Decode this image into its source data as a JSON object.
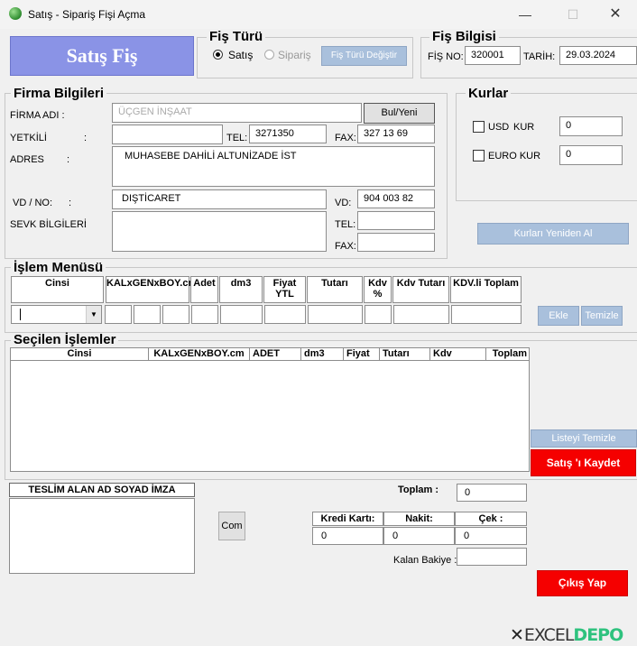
{
  "window": {
    "title": "Satış - Sipariş Fişi Açma",
    "minimize": "—",
    "maximize": "☐",
    "close": "✕"
  },
  "banner": {
    "text": "Satış Fiş"
  },
  "fis_turu": {
    "title": "Fiş Türü",
    "option_satis": "Satış",
    "option_siparis": "Sipariş",
    "selected": "Satış",
    "change_button": "Fiş Türü Değiştir"
  },
  "fis_bilgisi": {
    "title": "Fiş Bilgisi",
    "fis_no_label": "FİŞ NO:",
    "fis_no": "320001",
    "tarih_label": "TARİH:",
    "tarih": "29.03.2024"
  },
  "firma": {
    "title": "Firma Bilgileri",
    "firma_adi_label": "FİRMA ADI :",
    "firma_adi": "ÜÇGEN İNŞAAT",
    "find_button": "Bul/Yeni",
    "yetkili_label": "YETKİLİ",
    "yetkili_colon": ":",
    "yetkili": "",
    "tel_label": "TEL:",
    "tel": "3271350",
    "fax_label": "FAX:",
    "fax": "327 13 69",
    "adres_label": "ADRES",
    "adres_colon": ":",
    "adres": "MUHASEBE DAHİLİ ALTUNİZADE İST",
    "vd_no_label": "VD / NO:",
    "vd_no_colon": ":",
    "vd_no": "DIŞTİCARET",
    "vd_label": "VD:",
    "vd": "904 003 82",
    "sevk_label": "SEVK BİLGİLERİ",
    "sevk_colon": ":",
    "sevk": "",
    "sevk_tel_label": "TEL:",
    "sevk_tel": "",
    "sevk_fax_label": "FAX:",
    "sevk_fax": ""
  },
  "kurlar": {
    "title": "Kurlar",
    "usd_label": "USD",
    "usd_kur_label": "KUR",
    "usd_value": "0",
    "euro_label": "EURO KUR",
    "euro_value": "0",
    "refresh_button": "Kurları Yeniden Al"
  },
  "islem": {
    "title": "İşlem Menüsü",
    "headers": [
      "Cinsi",
      "KALxGENxBOY.cm",
      "Adet",
      "dm3",
      "Fiyat YTL",
      "Tutarı",
      "Kdv %",
      "Kdv Tutarı",
      "KDV.li Toplam"
    ],
    "add_button": "Ekle",
    "clear_button": "Temizle"
  },
  "secilen": {
    "title": "Seçilen İşlemler",
    "headers": [
      "Cinsi",
      "KALxGENxBOY.cm",
      "ADET",
      "dm3",
      "Fiyat",
      "Tutarı",
      "Kdv",
      "Toplam"
    ],
    "clear_list_button": "Listeyi Temizle",
    "save_button": "Satış 'ı Kaydet"
  },
  "teslim": {
    "header": "TESLİM ALAN AD SOYAD İMZA",
    "com_button": "Com"
  },
  "totals": {
    "toplam_label": "Toplam :",
    "toplam": "0",
    "kredi_label": "Kredi Kartı:",
    "kredi": "0",
    "nakit_label": "Nakit:",
    "nakit": "0",
    "cek_label": "Çek :",
    "cek": "0",
    "kalan_label": "Kalan Bakiye :",
    "kalan": ""
  },
  "exit_button": "Çıkış Yap",
  "watermark": {
    "part1": "EXCEL",
    "part2": "DEPO"
  }
}
